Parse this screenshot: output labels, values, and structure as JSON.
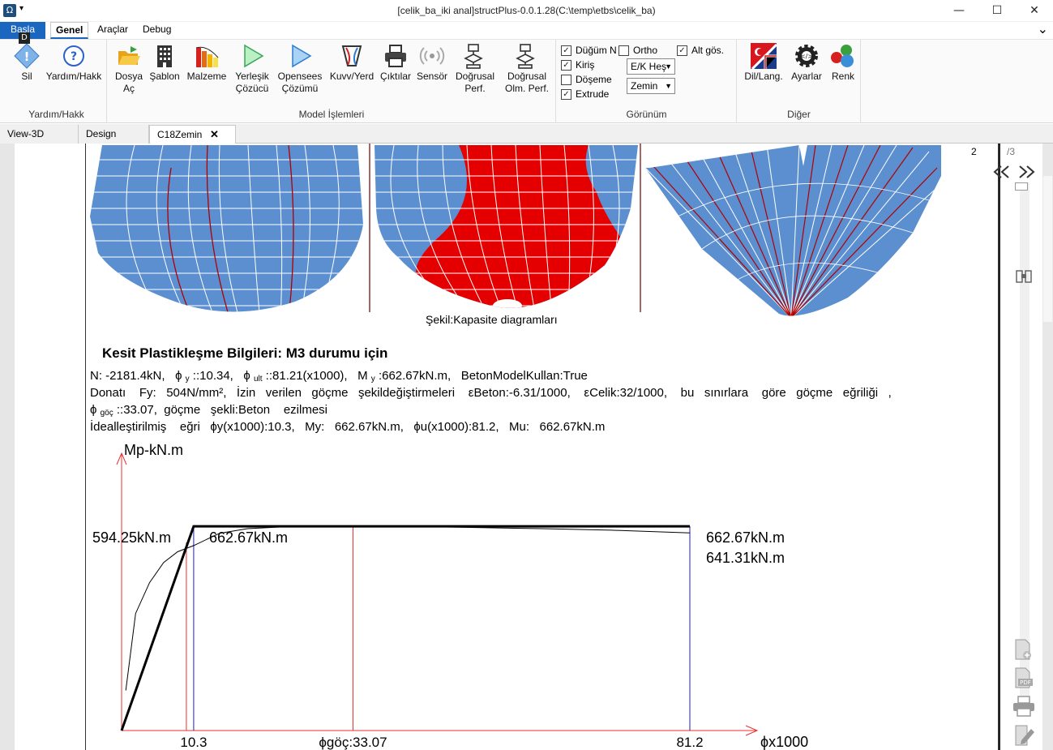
{
  "window": {
    "title": "[celik_ba_iki anal]structPlus-0.0.1.28(C:\\temp\\etbs\\celik_ba)",
    "minimize": "—",
    "maximize": "☐",
    "close": "✕"
  },
  "menu": {
    "tabs": [
      "Basla",
      "Genel",
      "Araçlar",
      "Debug"
    ],
    "keytip": "D",
    "collapse": "⌄"
  },
  "ribbon": {
    "groups": {
      "yardim": {
        "label": "Yardım/Hakk",
        "buttons": [
          {
            "label": "Sil",
            "icon": "diamond-info-icon"
          },
          {
            "label": "Yardım/Hakk",
            "icon": "help-circle-icon"
          }
        ]
      },
      "model": {
        "label": "Model İşlemleri",
        "buttons": [
          {
            "label1": "Dosya",
            "label2": "Aç",
            "icon": "folder-open-icon"
          },
          {
            "label1": "Şablon",
            "label2": "",
            "icon": "building-template-icon"
          },
          {
            "label1": "Malzeme",
            "label2": "",
            "icon": "material-chart-icon"
          },
          {
            "label1": "Yerleşik",
            "label2": "Çözücü",
            "icon": "play-green-icon"
          },
          {
            "label1": "Opensees",
            "label2": "Çözümü",
            "icon": "play-blue-icon"
          },
          {
            "label1": "Kuvv/Yerd",
            "label2": "",
            "icon": "force-displacement-icon"
          },
          {
            "label1": "Çıktılar",
            "label2": "",
            "icon": "printer-icon"
          },
          {
            "label1": "Sensör",
            "label2": "",
            "icon": "sensor-icon"
          },
          {
            "label1": "Doğrusal",
            "label2": "Perf.",
            "icon": "linear-perf-icon"
          },
          {
            "label1": "Doğrusal",
            "label2": "Olm. Perf.",
            "icon": "nonlinear-perf-icon"
          }
        ]
      },
      "gorunum": {
        "label": "Görünüm",
        "checks": [
          {
            "label": "Düğüm N",
            "checked": true
          },
          {
            "label": "Ortho",
            "checked": false
          },
          {
            "label": "Alt gös.",
            "checked": true
          },
          {
            "label": "Kiriş",
            "checked": true
          },
          {
            "label": "Döşeme",
            "checked": false
          },
          {
            "label": "Extrude",
            "checked": true
          }
        ],
        "selects": [
          "E/K Heş",
          "Zemin"
        ]
      },
      "diger": {
        "label": "Diğer",
        "buttons": [
          {
            "label": "Dil/Lang.",
            "icon": "language-flags-icon"
          },
          {
            "label": "Ayarlar",
            "icon": "settings-gear-icon"
          },
          {
            "label": "Renk",
            "icon": "color-balls-icon"
          }
        ]
      }
    }
  },
  "doctabs": [
    "View-3D",
    "Design",
    "C18Zemin"
  ],
  "doctab_close": "✕",
  "pager": {
    "current": "2",
    "total": "/3"
  },
  "document": {
    "caption": "Şekil:Kapasite diagramları",
    "heading": "Kesit Plastikleşme Bilgileri: M3 durumu için",
    "line1": {
      "n": "N:   -2181.4kN,",
      "phi": "ϕ",
      "phiy_sub": "y",
      "phiy_val": " ::10.34,",
      "phiult_sub": "ult",
      "phiult_val": " ::81.21(x1000),",
      "m": "M",
      "my_sub": "y",
      "my_val": " :662.67kN.m,",
      "beton": "BetonModelKullan:True"
    },
    "line2": "Donatı    Fy:   504N/mm²,   İzin   verilen   göçme   şekildeğiştirmeleri    εBeton:-6.31/1000,    εCelik:32/1000,    bu   sınırlara    göre   göçme   eğriliği   ,",
    "line3": {
      "phi": "ϕ",
      "sub": "göç",
      "rest": " ::33.07,  göçme   şekli:Beton    ezilmesi"
    },
    "line4": "İdealleştirilmiş    eğri   ϕy(x1000):10.3,   My:   662.67kN.m,   ϕu(x1000):81.2,   Mu:   662.67kN.m"
  },
  "chart_data": {
    "type": "line",
    "ylabel": "Mp-kN.m",
    "xlabel": "ϕx1000",
    "x_markers": [
      {
        "x": 10.3,
        "label": "10.3"
      },
      {
        "x": 33.07,
        "label": "ϕgöç:33.07"
      },
      {
        "x": 81.2,
        "label": "81.2"
      }
    ],
    "annotations": [
      "594.25kN.m",
      "662.67kN.m",
      "662.67kN.m",
      "641.31kN.m"
    ],
    "series": [
      {
        "values_x": [
          0,
          10.3,
          81.2
        ],
        "values_y": [
          0,
          662.67,
          662.67
        ]
      },
      {
        "values_x": [
          0.6,
          2,
          4,
          6,
          8,
          10.3,
          14,
          18,
          24,
          33.07,
          45,
          60,
          70,
          81.2
        ],
        "values_y": [
          130,
          380,
          480,
          545,
          580,
          600,
          640,
          655,
          662,
          663,
          661,
          655,
          650,
          641.31
        ]
      }
    ],
    "xlim": [
      0,
      81.2
    ],
    "ylim": [
      0,
      663
    ]
  },
  "colors": {
    "accent": "#1b67c0",
    "capacity_blue": "#5b8fd0",
    "capacity_red": "#e40000",
    "axis_red": "#e83030",
    "marker_blue": "#2020a0"
  }
}
